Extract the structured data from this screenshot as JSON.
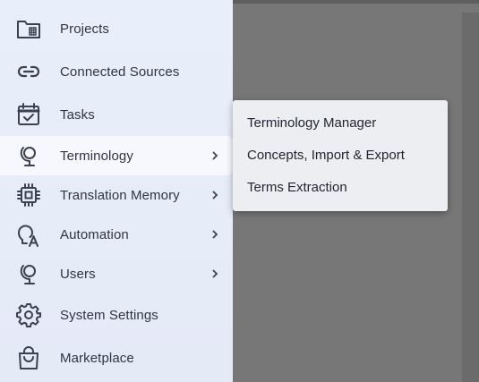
{
  "sidebar": {
    "items": [
      {
        "label": "Projects",
        "icon": "projects-icon"
      },
      {
        "label": "Connected Sources",
        "icon": "link-icon"
      },
      {
        "label": "Tasks",
        "icon": "calendar-check-icon"
      },
      {
        "label": "Terminology",
        "icon": "globe-stand-icon",
        "has_submenu": true,
        "active": true
      },
      {
        "label": "Translation Memory",
        "icon": "chip-icon",
        "has_submenu": true
      },
      {
        "label": "Automation",
        "icon": "bulb-a-icon",
        "has_submenu": true
      },
      {
        "label": "Users",
        "icon": "globe-stand-icon",
        "has_submenu": true
      },
      {
        "label": "System Settings",
        "icon": "gear-icon"
      },
      {
        "label": "Marketplace",
        "icon": "shopping-bag-icon"
      }
    ]
  },
  "flyout": {
    "items": [
      {
        "label": "Terminology Manager"
      },
      {
        "label": "Concepts, Import & Export"
      },
      {
        "label": "Terms Extraction"
      }
    ]
  },
  "colors": {
    "sidebar_bg": "#e8edfa",
    "active_bg": "#f7f8fd",
    "icon_stroke": "#3b4150",
    "text": "#2f3542",
    "overlay": "#777777"
  }
}
